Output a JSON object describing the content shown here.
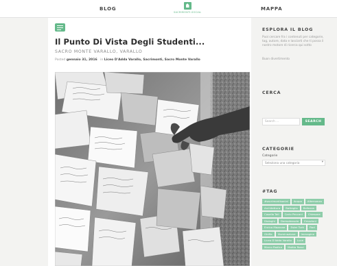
{
  "header": {
    "nav_blog": "BLOG",
    "logo_text": "SACRIMONTI.SOCIAL",
    "nav_map": "MAPPA",
    "accent_color": "#64b98a"
  },
  "post": {
    "icon": "chat-icon",
    "title": "Il Punto Di Vista Degli Studenti...",
    "subtitle": "SACRO MONTE VARALLO, VARALLO",
    "meta": {
      "posted_prefix": "Posted",
      "date": "gennaio 31, 2016",
      "in_word": "in",
      "categories": "Liceo D'Adda Varallo, Sacrimonti, Sacro Monte Varallo"
    }
  },
  "sidebar": {
    "explore": {
      "heading": "ESPLORA IL BLOG",
      "text": "Puoi cercare fra i contenuti per categorie, tag, autore, data e lasciarti che ti possa il nostro motore di ricerca qui sotto",
      "greeting": "Buon divertimento"
    },
    "search": {
      "heading": "CERCA",
      "placeholder": "Search ...",
      "button": "SEARCH"
    },
    "categories": {
      "heading": "CATEGORIE",
      "label": "Categorie",
      "selected": "Seleziona una categoria"
    },
    "tags": {
      "heading": "#TAG",
      "items": [
        "#sacrimontisocial",
        "Acqua",
        "Alternanza",
        "Architettura",
        "Battaglio",
        "Bellezza",
        "Casella Tali",
        "Carlo Pecconi",
        "Chiesone",
        "Dialoghi",
        "Domodossola",
        "Emozioni",
        "Enrica Mazzone",
        "Ester Torti",
        "Fiori",
        "Ghiffa",
        "Illuminazione",
        "Immagine",
        "Liceo D'Adda Varallo",
        "Luce",
        "Marco Radice",
        "Mattia Rossi"
      ]
    }
  }
}
